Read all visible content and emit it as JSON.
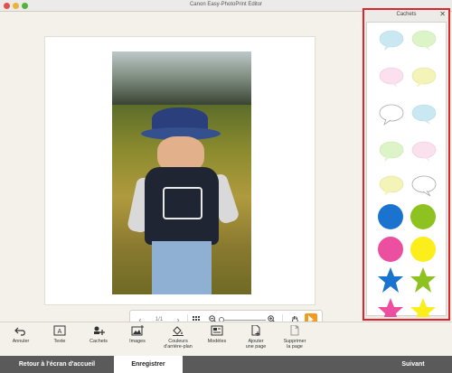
{
  "window": {
    "title": "Canon Easy-PhotoPrint Editor"
  },
  "navigation": {
    "page_indicator": "1/1"
  },
  "stickers_panel": {
    "title": "Cachets",
    "stickers": [
      {
        "name": "bubble-blue-dotted-icon",
        "color": "#c9e8f2"
      },
      {
        "name": "bubble-green-icon",
        "color": "#dcf4c8"
      },
      {
        "name": "bubble-pink-icon",
        "color": "#fbe0ee"
      },
      {
        "name": "bubble-yellow-icon",
        "color": "#f4f4b8"
      },
      {
        "name": "bubble-white-icon",
        "color": "#ffffff"
      },
      {
        "name": "bubble-blue-dotted-2-icon",
        "color": "#c9e8f2"
      },
      {
        "name": "bubble-green-2-icon",
        "color": "#dcf4c8"
      },
      {
        "name": "bubble-pink-2-icon",
        "color": "#fbe0ee"
      },
      {
        "name": "bubble-yellow-2-icon",
        "color": "#f4f4b8"
      },
      {
        "name": "bubble-white-2-icon",
        "color": "#ffffff"
      },
      {
        "name": "circle-blue-icon",
        "color": "#1a73cf"
      },
      {
        "name": "circle-green-icon",
        "color": "#8ec220"
      },
      {
        "name": "circle-pink-icon",
        "color": "#ec4fa0"
      },
      {
        "name": "circle-yellow-icon",
        "color": "#fbee1a"
      },
      {
        "name": "star-blue-icon",
        "color": "#1a73cf"
      },
      {
        "name": "star-green-icon",
        "color": "#8ec220"
      },
      {
        "name": "star-pink-icon",
        "color": "#ec4fa0"
      },
      {
        "name": "star-yellow-icon",
        "color": "#fbee1a"
      }
    ]
  },
  "toolbar": {
    "undo": "Annuler",
    "text": "Texte",
    "stamps": "Cachets",
    "images": "Images",
    "background": "Couleurs\nd'arrière-plan",
    "templates": "Modèles",
    "add_page": "Ajouter\nune page",
    "delete_page": "Supprimer\nla page"
  },
  "bottom": {
    "home": "Retour à l'écran d'accueil",
    "save": "Enregistrer",
    "next": "Suivant"
  },
  "colors": {
    "panel_highlight": "#e0242c",
    "cursor_tool": "#f39a1f"
  }
}
